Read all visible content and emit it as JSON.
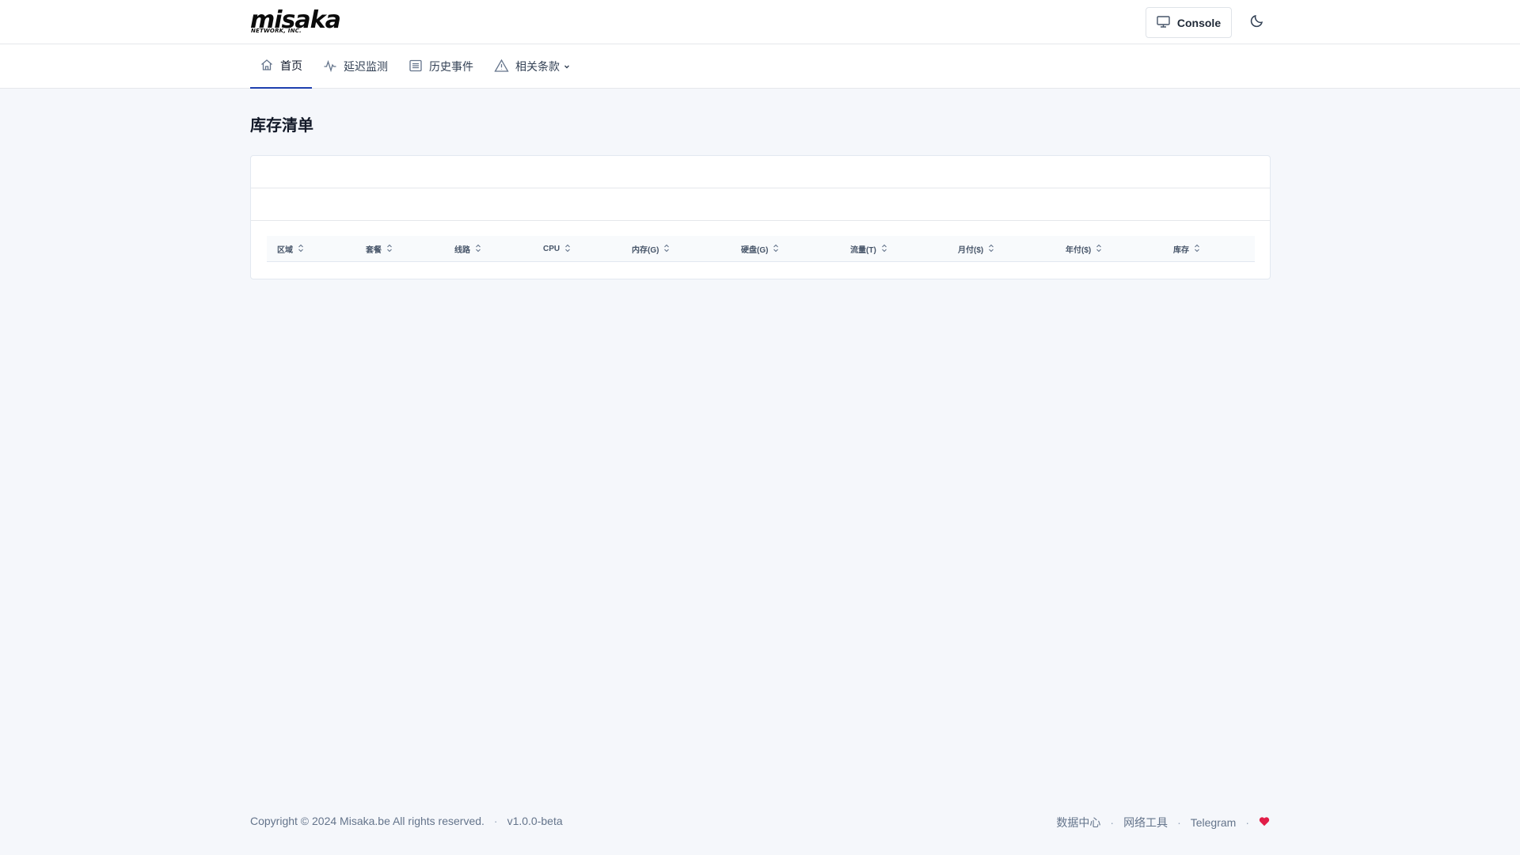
{
  "brand": {
    "logo_text": "misaka",
    "logo_subtext": "NETWORK, INC."
  },
  "header": {
    "console_label": "Console",
    "console_icon": "monitor-icon",
    "theme_icon": "moon-icon"
  },
  "nav": {
    "items": [
      {
        "label": "首页",
        "icon": "home-icon",
        "active": true
      },
      {
        "label": "延迟监测",
        "icon": "activity-icon"
      },
      {
        "label": "历史事件",
        "icon": "list-icon"
      },
      {
        "label": "相关条款",
        "icon": "alert-triangle-icon",
        "dropdown": true
      }
    ]
  },
  "page": {
    "title": "库存清单"
  },
  "table": {
    "columns": [
      "区域",
      "套餐",
      "线路",
      "CPU",
      "内存(G)",
      "硬盘(G)",
      "流量(T)",
      "月付($)",
      "年付($)",
      "库存"
    ],
    "rows": []
  },
  "footer": {
    "copyright": "Copyright © 2024 Misaka.be All rights reserved.",
    "version": "v1.0.0-beta",
    "links": [
      "数据中心",
      "网络工具",
      "Telegram"
    ],
    "separator": "·",
    "heart_color": "#e11d48"
  }
}
